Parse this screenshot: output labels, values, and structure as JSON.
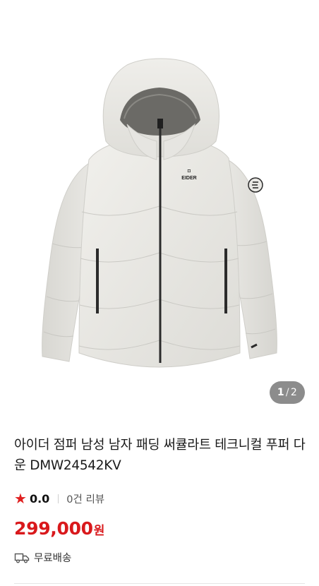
{
  "product": {
    "image_alt": "",
    "pager": {
      "current": "1",
      "separator": "/",
      "total": "2"
    },
    "title": "아이더 점퍼 남성 남자 패딩 써큘라트 테크니컬 푸퍼 다운 DMW24542KV",
    "rating": {
      "star_icon": "star-icon",
      "value": "0.0",
      "review_text": "0건 리뷰"
    },
    "price": {
      "amount": "299,000",
      "currency": "원"
    },
    "shipping": {
      "icon": "truck-icon",
      "label": "무료배송"
    }
  },
  "colors": {
    "price": "#d9191c",
    "star": "#e02020",
    "pager_bg": "#8c8c8c"
  }
}
